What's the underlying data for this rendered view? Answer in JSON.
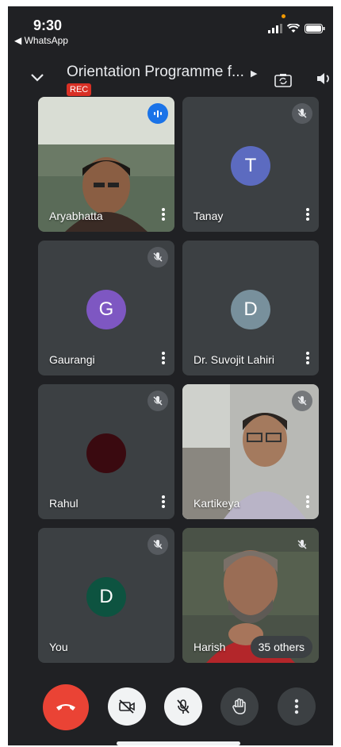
{
  "status_bar": {
    "time": "9:30",
    "back_app": "◀ WhatsApp"
  },
  "header": {
    "title": "Orientation Programme f...",
    "rec_badge": "REC"
  },
  "tiles": [
    {
      "name": "Aryabhatta",
      "state": "speaking",
      "type": "video"
    },
    {
      "name": "Tanay",
      "state": "muted",
      "type": "avatar",
      "initial": "T",
      "color": "#5c6bc0"
    },
    {
      "name": "Gaurangi",
      "state": "muted",
      "type": "avatar",
      "initial": "G",
      "color": "#7e57c2"
    },
    {
      "name": "Dr. Suvojit Lahiri",
      "state": "muted",
      "type": "avatar",
      "initial": "D",
      "color": "#78909c"
    },
    {
      "name": "Rahul",
      "state": "muted",
      "type": "avatar",
      "initial": "",
      "color": "#3a0a10"
    },
    {
      "name": "Kartikeya",
      "state": "muted",
      "type": "video"
    },
    {
      "name": "You",
      "state": "muted",
      "type": "avatar",
      "initial": "D",
      "color": "#0d5340"
    },
    {
      "name": "Harish",
      "state": "muted",
      "type": "video",
      "others": "35 others"
    }
  ],
  "controls": {
    "end_call_color": "#ea4335",
    "items": [
      "end-call",
      "camera-off",
      "mic-off",
      "raise-hand",
      "more-options"
    ]
  }
}
